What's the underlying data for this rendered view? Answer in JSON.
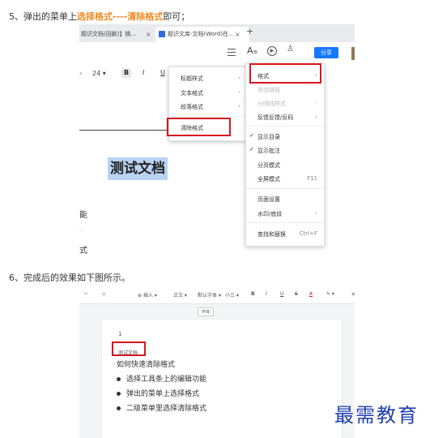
{
  "step5": {
    "prefix": "5、弹出的菜单上",
    "highlight": "选择格式----清除格式",
    "suffix": "即可；"
  },
  "step6": {
    "text": "6、完成后的效果如下图所示。"
  },
  "shot1": {
    "tabs": [
      "题识文档(回款)】桃…",
      "题识文库-文档(Word)在…"
    ],
    "tab_close": "×",
    "new_tab": "+",
    "font_size": "24",
    "bold": "B",
    "italic": "I",
    "underline": "U",
    "share_label": "分享",
    "doc_title": "测试文档",
    "side_texts": [
      "能",
      "式"
    ],
    "submenu": [
      {
        "label": "标题样式",
        "arrow": "›"
      },
      {
        "label": "文本格式",
        "arrow": "›"
      },
      {
        "label": "段落格式",
        "arrow": "›"
      },
      {
        "label": "清除格式",
        "arrow": ""
      }
    ],
    "main_menu": [
      {
        "label": "格式",
        "arrow": "›",
        "disabled": false
      },
      {
        "label": "添加链接",
        "arrow": "",
        "disabled": true
      },
      {
        "label": "分隔线样式",
        "arrow": "›",
        "disabled": true
      },
      {
        "label": "反馈反馈/反码",
        "arrow": "›",
        "disabled": false
      },
      {
        "label": "显示目录",
        "arrow": "",
        "check": true
      },
      {
        "label": "显示批注",
        "arrow": "",
        "check": true
      },
      {
        "label": "分页模式",
        "arrow": ""
      },
      {
        "label": "全屏模式",
        "arrow": "F11"
      },
      {
        "label": "页面设置",
        "arrow": ""
      },
      {
        "label": "水印/底纹",
        "arrow": "›"
      },
      {
        "label": "查找和替换",
        "arrow": "Ctrl+F"
      }
    ],
    "checkmark": "✓"
  },
  "shot2": {
    "toolbar": [
      "插入",
      "正文",
      "默认字体",
      "小三",
      "B",
      "I",
      "U",
      "S",
      "A",
      "A"
    ],
    "tooltip": "字体",
    "line_number": "1",
    "cleared_text": "测试文档",
    "heading": "如何快速清除格式",
    "bullets": [
      "选择工具条上的编辑功能",
      "弹出的菜单上选择格式",
      "二级菜单里选择清除格式"
    ]
  },
  "watermark": "最需教育",
  "colors": {
    "highlight": "#f08a24",
    "red_box": "#d9161c",
    "share_btn": "#1677ff",
    "selection": "#b9d3f3"
  }
}
